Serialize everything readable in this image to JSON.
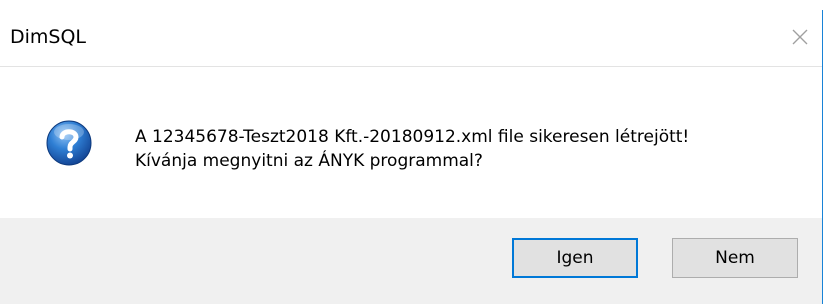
{
  "window": {
    "title": "DimSQL"
  },
  "message": {
    "line1": "A 12345678-Teszt2018 Kft.-20180912.xml file sikeresen létrejött!",
    "line2": "Kívánja megnyitni az ÁNYK programmal?"
  },
  "buttons": {
    "yes_label": "Igen",
    "no_label": "Nem"
  },
  "icons": {
    "message_icon": "question-icon",
    "close_icon": "close-icon"
  },
  "colors": {
    "accent": "#0078d7",
    "footer_bg": "#f0f0f0",
    "button_bg": "#e1e1e1"
  }
}
